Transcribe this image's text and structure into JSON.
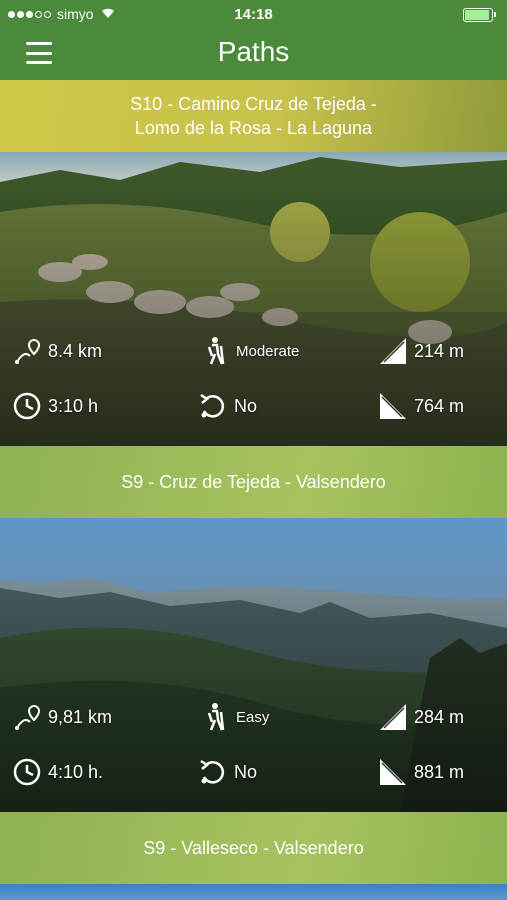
{
  "status": {
    "carrier": "simyo",
    "time": "14:18",
    "battery_level": 0.92
  },
  "header": {
    "title": "Paths",
    "menu_icon": "hamburger-menu-icon"
  },
  "colors": {
    "nav": "#4a8a3a",
    "header_yellow": "#c8c24a",
    "header_green": "#9dbc56"
  },
  "paths": [
    {
      "title_line1": "S10 - Camino Cruz de Tejeda -",
      "title_line2": "Lomo de la Rosa - La Laguna",
      "distance": "8.4 km",
      "difficulty": "Moderate",
      "ascent": "214 m",
      "duration": "3:10 h",
      "circular": "No",
      "descent": "764 m"
    },
    {
      "title_line1": "S9 - Cruz de Tejeda - Valsendero",
      "title_line2": "",
      "distance": "9,81 km",
      "difficulty": "Easy",
      "ascent": "284 m",
      "duration": "4:10 h.",
      "circular": "No",
      "descent": "881 m"
    },
    {
      "title_line1": "S9 - Valleseco - Valsendero",
      "title_line2": ""
    }
  ]
}
